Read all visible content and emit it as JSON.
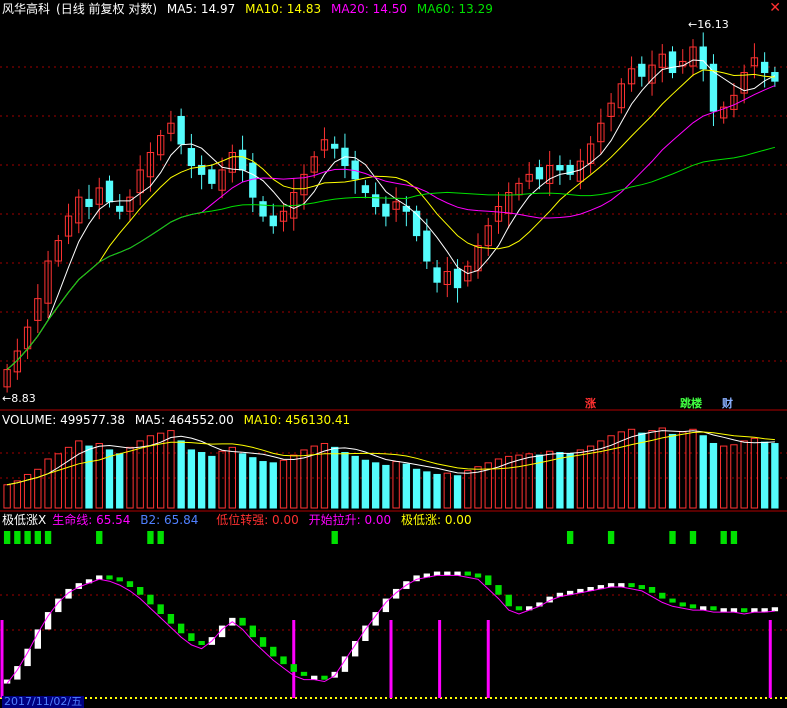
{
  "header": {
    "stock_name": "风华高科",
    "period": "(日线 前复权 对数)",
    "ma5": "MA5: 14.97",
    "ma10": "MA10: 14.83",
    "ma20": "MA20: 14.50",
    "ma60": "MA60: 13.29"
  },
  "price_panel": {
    "high_label": "16.13",
    "low_label": "8.83",
    "event_tags": [
      "涨",
      "跳楼",
      "财"
    ]
  },
  "volume_panel": {
    "volume": "VOLUME: 499577.38",
    "ma5": "MA5: 464552.00",
    "ma10": "MA10: 456130.41"
  },
  "indicator_panel": {
    "name": "极低涨X",
    "life_line": "生命线: 65.54",
    "b2": "B2: 65.84",
    "low_strong": "低位转强: 0.00",
    "start_pull": "开始拉升: 0.00",
    "extreme_low": "极低涨: 0.00"
  },
  "date_axis": {
    "first_date": "2017/11/02/五"
  },
  "colors": {
    "up": "#ff3232",
    "down": "#54fcfc",
    "ma5": "#ffffff",
    "ma10": "#ffff00",
    "ma20": "#ff00ff",
    "ma60": "#00e000",
    "grid": "#a00000",
    "signal": "#00e000",
    "marker": "#ff00ff"
  },
  "chart_data": {
    "type": "candlestick",
    "ylim": [
      8.5,
      16.5
    ],
    "y_scale": "log",
    "grid": true,
    "high": 16.13,
    "low": 8.83,
    "closes": [
      9.0,
      9.3,
      9.7,
      10.2,
      10.9,
      11.3,
      11.8,
      12.2,
      12.0,
      12.4,
      12.1,
      11.9,
      12.2,
      12.8,
      13.2,
      13.6,
      13.9,
      13.4,
      12.9,
      12.7,
      12.5,
      12.8,
      13.2,
      12.8,
      12.2,
      11.8,
      11.6,
      11.9,
      12.3,
      12.7,
      13.1,
      13.5,
      13.3,
      12.9,
      12.6,
      12.3,
      12.0,
      11.8,
      12.1,
      11.9,
      11.4,
      10.9,
      10.5,
      10.7,
      10.4,
      10.8,
      11.2,
      11.6,
      12.0,
      12.3,
      12.5,
      12.7,
      12.6,
      12.9,
      12.8,
      12.7,
      13.0,
      13.4,
      13.9,
      14.4,
      14.9,
      15.3,
      15.1,
      15.4,
      15.7,
      15.2,
      15.5,
      15.9,
      15.3,
      14.2,
      14.3,
      14.6,
      15.2,
      15.6,
      15.2,
      14.97
    ],
    "volume": [
      180,
      210,
      260,
      300,
      380,
      420,
      470,
      520,
      480,
      500,
      450,
      420,
      470,
      520,
      560,
      580,
      600,
      520,
      450,
      430,
      400,
      440,
      470,
      420,
      390,
      360,
      350,
      370,
      410,
      450,
      480,
      500,
      470,
      430,
      400,
      370,
      350,
      330,
      360,
      340,
      300,
      280,
      260,
      270,
      250,
      290,
      320,
      350,
      380,
      400,
      410,
      420,
      410,
      440,
      430,
      420,
      450,
      480,
      520,
      560,
      590,
      610,
      580,
      600,
      620,
      570,
      590,
      610,
      560,
      500,
      480,
      490,
      520,
      540,
      510,
      499.6
    ],
    "indicator": [
      28,
      35,
      44,
      54,
      63,
      70,
      75,
      78,
      80,
      82,
      81,
      79,
      76,
      72,
      67,
      62,
      57,
      52,
      48,
      46,
      50,
      56,
      60,
      56,
      50,
      45,
      40,
      36,
      32,
      30,
      30,
      29,
      32,
      40,
      48,
      56,
      63,
      70,
      75,
      79,
      82,
      83,
      84,
      84,
      84,
      83,
      82,
      77,
      72,
      66,
      64,
      66,
      68,
      71,
      73,
      74,
      75,
      76,
      77,
      78,
      78,
      77,
      76,
      73,
      70,
      68,
      67,
      66,
      66,
      65,
      65,
      65,
      64,
      65,
      65,
      65.5
    ],
    "signals": [
      0,
      1,
      2,
      3,
      4,
      9,
      14,
      15,
      32,
      55,
      59,
      65,
      67,
      70,
      71
    ],
    "markers": [
      0,
      30,
      40,
      45,
      50,
      79
    ]
  }
}
